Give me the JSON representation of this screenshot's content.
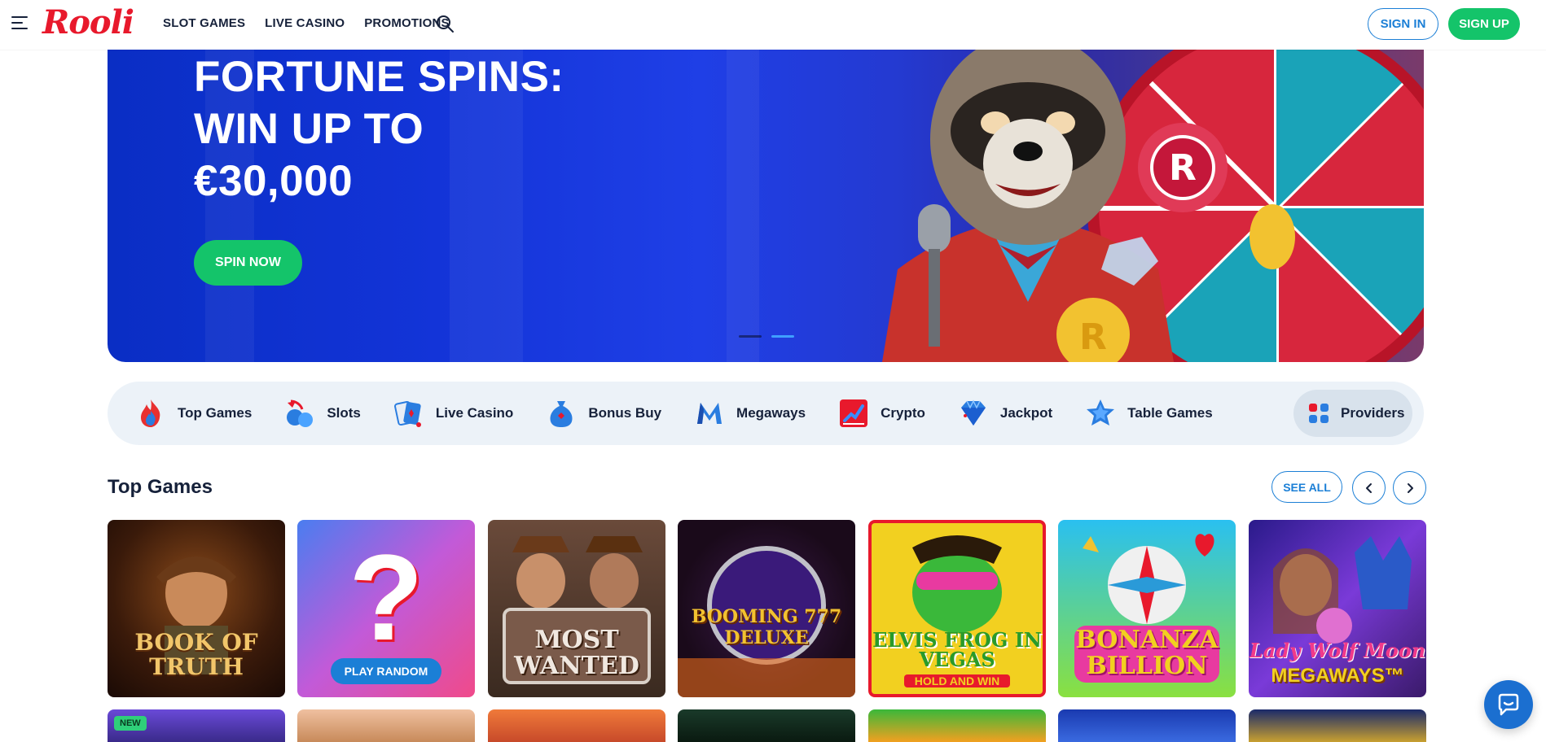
{
  "header": {
    "logo": "Rooli",
    "nav": [
      "SLOT GAMES",
      "LIVE CASINO",
      "PROMOTIONS"
    ],
    "sign_in": "SIGN IN",
    "sign_up": "SIGN UP"
  },
  "hero": {
    "title": "FORTUNE SPINS:\nWIN UP TO\n€30,000",
    "cta": "SPIN NOW",
    "slides_total": 2,
    "active_slide": 2
  },
  "categories": [
    {
      "label": "Top Games",
      "icon": "flame-icon"
    },
    {
      "label": "Slots",
      "icon": "cherries-icon"
    },
    {
      "label": "Live Casino",
      "icon": "cards-icon"
    },
    {
      "label": "Bonus Buy",
      "icon": "money-bag-icon"
    },
    {
      "label": "Megaways",
      "icon": "megaways-icon"
    },
    {
      "label": "Crypto",
      "icon": "chart-icon"
    },
    {
      "label": "Jackpot",
      "icon": "diamond-icon"
    },
    {
      "label": "Table Games",
      "icon": "star-icon"
    }
  ],
  "providers_label": "Providers",
  "section": {
    "title": "Top Games",
    "see_all": "SEE ALL"
  },
  "games": [
    {
      "title": "BOOK OF TRUTH"
    },
    {
      "title": "",
      "button": "PLAY RANDOM"
    },
    {
      "title": "MOST WANTED"
    },
    {
      "title": "BOOMING 777 DELUXE"
    },
    {
      "title": "ELVIS FROG IN VEGAS",
      "subtitle": "HOLD AND WIN"
    },
    {
      "title": "BONANZA BILLION"
    },
    {
      "title": "Lady Wolf Moon",
      "subtitle": "MEGAWAYS™"
    }
  ],
  "row2_badge": "NEW",
  "colors": {
    "brand_red": "#e8192c",
    "accent_blue": "#1b7fd6",
    "cta_green": "#14c46a",
    "hero_blue": "#1334d8"
  }
}
